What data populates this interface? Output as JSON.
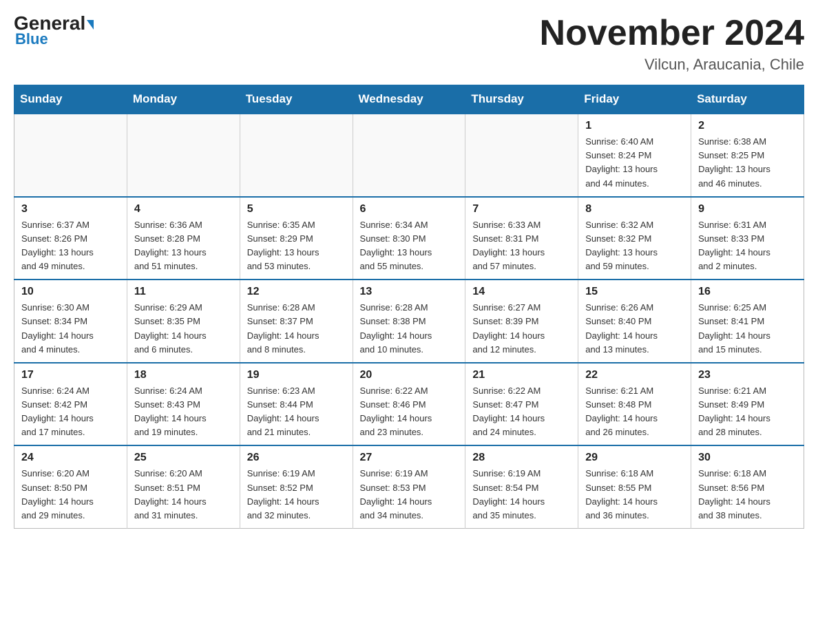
{
  "header": {
    "logo_general": "General",
    "logo_blue": "Blue",
    "month_title": "November 2024",
    "location": "Vilcun, Araucania, Chile"
  },
  "days_of_week": [
    "Sunday",
    "Monday",
    "Tuesday",
    "Wednesday",
    "Thursday",
    "Friday",
    "Saturday"
  ],
  "weeks": [
    [
      {
        "day": "",
        "info": ""
      },
      {
        "day": "",
        "info": ""
      },
      {
        "day": "",
        "info": ""
      },
      {
        "day": "",
        "info": ""
      },
      {
        "day": "",
        "info": ""
      },
      {
        "day": "1",
        "info": "Sunrise: 6:40 AM\nSunset: 8:24 PM\nDaylight: 13 hours\nand 44 minutes."
      },
      {
        "day": "2",
        "info": "Sunrise: 6:38 AM\nSunset: 8:25 PM\nDaylight: 13 hours\nand 46 minutes."
      }
    ],
    [
      {
        "day": "3",
        "info": "Sunrise: 6:37 AM\nSunset: 8:26 PM\nDaylight: 13 hours\nand 49 minutes."
      },
      {
        "day": "4",
        "info": "Sunrise: 6:36 AM\nSunset: 8:28 PM\nDaylight: 13 hours\nand 51 minutes."
      },
      {
        "day": "5",
        "info": "Sunrise: 6:35 AM\nSunset: 8:29 PM\nDaylight: 13 hours\nand 53 minutes."
      },
      {
        "day": "6",
        "info": "Sunrise: 6:34 AM\nSunset: 8:30 PM\nDaylight: 13 hours\nand 55 minutes."
      },
      {
        "day": "7",
        "info": "Sunrise: 6:33 AM\nSunset: 8:31 PM\nDaylight: 13 hours\nand 57 minutes."
      },
      {
        "day": "8",
        "info": "Sunrise: 6:32 AM\nSunset: 8:32 PM\nDaylight: 13 hours\nand 59 minutes."
      },
      {
        "day": "9",
        "info": "Sunrise: 6:31 AM\nSunset: 8:33 PM\nDaylight: 14 hours\nand 2 minutes."
      }
    ],
    [
      {
        "day": "10",
        "info": "Sunrise: 6:30 AM\nSunset: 8:34 PM\nDaylight: 14 hours\nand 4 minutes."
      },
      {
        "day": "11",
        "info": "Sunrise: 6:29 AM\nSunset: 8:35 PM\nDaylight: 14 hours\nand 6 minutes."
      },
      {
        "day": "12",
        "info": "Sunrise: 6:28 AM\nSunset: 8:37 PM\nDaylight: 14 hours\nand 8 minutes."
      },
      {
        "day": "13",
        "info": "Sunrise: 6:28 AM\nSunset: 8:38 PM\nDaylight: 14 hours\nand 10 minutes."
      },
      {
        "day": "14",
        "info": "Sunrise: 6:27 AM\nSunset: 8:39 PM\nDaylight: 14 hours\nand 12 minutes."
      },
      {
        "day": "15",
        "info": "Sunrise: 6:26 AM\nSunset: 8:40 PM\nDaylight: 14 hours\nand 13 minutes."
      },
      {
        "day": "16",
        "info": "Sunrise: 6:25 AM\nSunset: 8:41 PM\nDaylight: 14 hours\nand 15 minutes."
      }
    ],
    [
      {
        "day": "17",
        "info": "Sunrise: 6:24 AM\nSunset: 8:42 PM\nDaylight: 14 hours\nand 17 minutes."
      },
      {
        "day": "18",
        "info": "Sunrise: 6:24 AM\nSunset: 8:43 PM\nDaylight: 14 hours\nand 19 minutes."
      },
      {
        "day": "19",
        "info": "Sunrise: 6:23 AM\nSunset: 8:44 PM\nDaylight: 14 hours\nand 21 minutes."
      },
      {
        "day": "20",
        "info": "Sunrise: 6:22 AM\nSunset: 8:46 PM\nDaylight: 14 hours\nand 23 minutes."
      },
      {
        "day": "21",
        "info": "Sunrise: 6:22 AM\nSunset: 8:47 PM\nDaylight: 14 hours\nand 24 minutes."
      },
      {
        "day": "22",
        "info": "Sunrise: 6:21 AM\nSunset: 8:48 PM\nDaylight: 14 hours\nand 26 minutes."
      },
      {
        "day": "23",
        "info": "Sunrise: 6:21 AM\nSunset: 8:49 PM\nDaylight: 14 hours\nand 28 minutes."
      }
    ],
    [
      {
        "day": "24",
        "info": "Sunrise: 6:20 AM\nSunset: 8:50 PM\nDaylight: 14 hours\nand 29 minutes."
      },
      {
        "day": "25",
        "info": "Sunrise: 6:20 AM\nSunset: 8:51 PM\nDaylight: 14 hours\nand 31 minutes."
      },
      {
        "day": "26",
        "info": "Sunrise: 6:19 AM\nSunset: 8:52 PM\nDaylight: 14 hours\nand 32 minutes."
      },
      {
        "day": "27",
        "info": "Sunrise: 6:19 AM\nSunset: 8:53 PM\nDaylight: 14 hours\nand 34 minutes."
      },
      {
        "day": "28",
        "info": "Sunrise: 6:19 AM\nSunset: 8:54 PM\nDaylight: 14 hours\nand 35 minutes."
      },
      {
        "day": "29",
        "info": "Sunrise: 6:18 AM\nSunset: 8:55 PM\nDaylight: 14 hours\nand 36 minutes."
      },
      {
        "day": "30",
        "info": "Sunrise: 6:18 AM\nSunset: 8:56 PM\nDaylight: 14 hours\nand 38 minutes."
      }
    ]
  ]
}
